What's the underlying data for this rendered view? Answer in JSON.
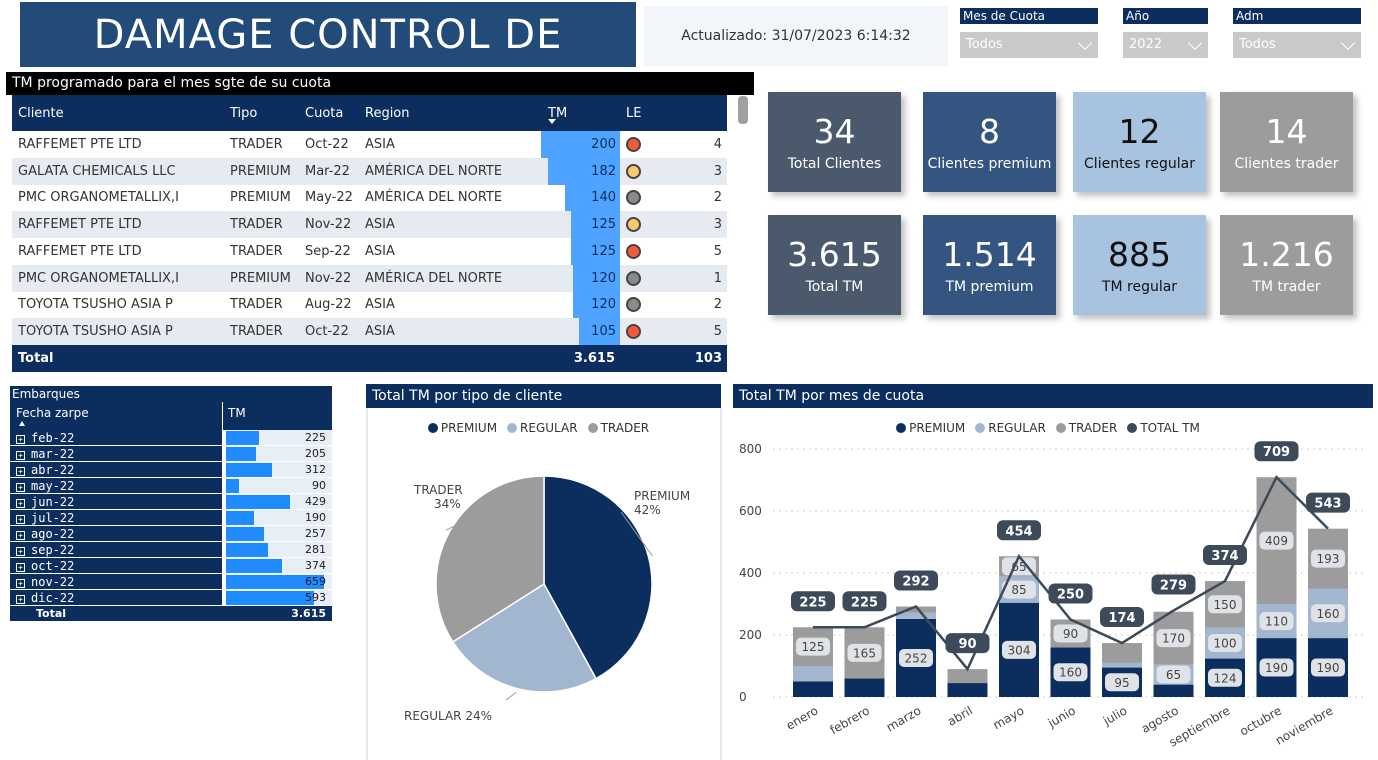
{
  "header": {
    "title": "DAMAGE CONTROL DE",
    "updated": "Actualizado: 31/07/2023 6:14:32"
  },
  "slicers": [
    {
      "label": "Mes de Cuota",
      "value": "Todos"
    },
    {
      "label": "Año",
      "value": "2022"
    },
    {
      "label": "Adm",
      "value": "Todos"
    }
  ],
  "tm_table": {
    "title": "TM programado para el mes sgte de su cuota",
    "columns": {
      "cliente": "Cliente",
      "tipo": "Tipo",
      "cuota": "Cuota",
      "region": "Region",
      "tm": "TM",
      "le": "LE"
    },
    "rows": [
      {
        "cliente": "RAFFEMET PTE LTD",
        "tipo": "TRADER",
        "cuota": "Oct-22",
        "region": "ASIA",
        "tm": "200",
        "le_color": "#f35a3a",
        "le": "4"
      },
      {
        "cliente": "GALATA CHEMICALS LLC",
        "tipo": "PREMIUM",
        "cuota": "Mar-22",
        "region": "AMÉRICA DEL NORTE",
        "tm": "182",
        "le_color": "#f7c96a",
        "le": "3"
      },
      {
        "cliente": "PMC ORGANOMETALLIX,I",
        "tipo": "PREMIUM",
        "cuota": "May-22",
        "region": "AMÉRICA DEL NORTE",
        "tm": "140",
        "le_color": "#8a8a8a",
        "le": "2"
      },
      {
        "cliente": "RAFFEMET PTE LTD",
        "tipo": "TRADER",
        "cuota": "Nov-22",
        "region": "ASIA",
        "tm": "125",
        "le_color": "#f7c96a",
        "le": "3"
      },
      {
        "cliente": "RAFFEMET PTE LTD",
        "tipo": "TRADER",
        "cuota": "Sep-22",
        "region": "ASIA",
        "tm": "125",
        "le_color": "#f35a3a",
        "le": "5"
      },
      {
        "cliente": "PMC ORGANOMETALLIX,I",
        "tipo": "PREMIUM",
        "cuota": "Nov-22",
        "region": "AMÉRICA DEL NORTE",
        "tm": "120",
        "le_color": "#8a8a8a",
        "le": "1"
      },
      {
        "cliente": "TOYOTA TSUSHO ASIA P",
        "tipo": "TRADER",
        "cuota": "Aug-22",
        "region": "ASIA",
        "tm": "120",
        "le_color": "#8a8a8a",
        "le": "2"
      },
      {
        "cliente": "TOYOTA TSUSHO ASIA P",
        "tipo": "TRADER",
        "cuota": "Oct-22",
        "region": "ASIA",
        "tm": "105",
        "le_color": "#f35a3a",
        "le": "5"
      }
    ],
    "total": {
      "label": "Total",
      "tm": "3.615",
      "le": "103"
    }
  },
  "kpis": [
    {
      "value": "34",
      "label": "Total Clientes",
      "cls": "k1"
    },
    {
      "value": "8",
      "label": "Clientes premium",
      "cls": "k2"
    },
    {
      "value": "12",
      "label": "Clientes regular",
      "cls": "k3"
    },
    {
      "value": "14",
      "label": "Clientes trader",
      "cls": "k4"
    },
    {
      "value": "3.615",
      "label": "Total TM",
      "cls": "k1"
    },
    {
      "value": "1.514",
      "label": "TM premium",
      "cls": "k2"
    },
    {
      "value": "885",
      "label": "TM regular",
      "cls": "k3"
    },
    {
      "value": "1.216",
      "label": "TM trader",
      "cls": "k4"
    }
  ],
  "embarques": {
    "title": "Embarques",
    "col_fecha": "Fecha zarpe",
    "col_tm": "TM",
    "rows": [
      {
        "month": "feb-22",
        "tm": 225
      },
      {
        "month": "mar-22",
        "tm": 205
      },
      {
        "month": "abr-22",
        "tm": 312
      },
      {
        "month": "may-22",
        "tm": 90
      },
      {
        "month": "jun-22",
        "tm": 429
      },
      {
        "month": "jul-22",
        "tm": 190
      },
      {
        "month": "ago-22",
        "tm": 257
      },
      {
        "month": "sep-22",
        "tm": 281
      },
      {
        "month": "oct-22",
        "tm": 374
      },
      {
        "month": "nov-22",
        "tm": 659
      },
      {
        "month": "dic-22",
        "tm": 593
      }
    ],
    "total_label": "Total",
    "total": "3.615"
  },
  "chart_data": [
    {
      "type": "pie",
      "title": "Total TM por tipo de cliente",
      "legend": [
        "PREMIUM",
        "REGULAR",
        "TRADER"
      ],
      "slices": [
        {
          "name": "PREMIUM",
          "pct": 42,
          "label": "PREMIUM",
          "pct_label": "42%",
          "color": "#0b2e5e"
        },
        {
          "name": "REGULAR",
          "pct": 24,
          "label": "REGULAR",
          "pct_label": "24%",
          "color": "#a2b7cf"
        },
        {
          "name": "TRADER",
          "pct": 34,
          "label": "TRADER",
          "pct_label": "34%",
          "color": "#9c9c9c"
        }
      ]
    },
    {
      "type": "bar",
      "title": "Total TM por mes de cuota",
      "legend": [
        "PREMIUM",
        "REGULAR",
        "TRADER",
        "TOTAL TM"
      ],
      "colors": {
        "PREMIUM": "#0b2e5e",
        "REGULAR": "#a2b7cf",
        "TRADER": "#9c9c9c",
        "TOTAL TM": "#3d4a5a"
      },
      "categories": [
        "enero",
        "febrero",
        "marzo",
        "abril",
        "mayo",
        "junio",
        "julio",
        "agosto",
        "septiembre",
        "octubre",
        "noviembre"
      ],
      "yticks": [
        0,
        200,
        400,
        600,
        800
      ],
      "ylim": [
        0,
        800
      ],
      "series": [
        {
          "name": "PREMIUM",
          "values": [
            50,
            60,
            252,
            45,
            304,
            160,
            95,
            40,
            124,
            190,
            190
          ]
        },
        {
          "name": "REGULAR",
          "values": [
            50,
            0,
            20,
            0,
            85,
            0,
            15,
            65,
            100,
            110,
            160
          ]
        },
        {
          "name": "TRADER",
          "values": [
            125,
            165,
            20,
            45,
            65,
            90,
            64,
            170,
            150,
            409,
            193
          ]
        }
      ],
      "segment_labels": [
        {
          "PREMIUM": "",
          "REGULAR": "",
          "TRADER": "125"
        },
        {
          "PREMIUM": "",
          "REGULAR": "",
          "TRADER": "165"
        },
        {
          "PREMIUM": "252",
          "REGULAR": "",
          "TRADER": ""
        },
        {
          "PREMIUM": "",
          "REGULAR": "",
          "TRADER": ""
        },
        {
          "PREMIUM": "304",
          "REGULAR": "85",
          "TRADER": "65"
        },
        {
          "PREMIUM": "160",
          "REGULAR": "",
          "TRADER": "90"
        },
        {
          "PREMIUM": "95",
          "REGULAR": "",
          "TRADER": ""
        },
        {
          "PREMIUM": "",
          "REGULAR": "65",
          "TRADER": "170"
        },
        {
          "PREMIUM": "124",
          "REGULAR": "100",
          "TRADER": "150"
        },
        {
          "PREMIUM": "190",
          "REGULAR": "110",
          "TRADER": "409"
        },
        {
          "PREMIUM": "190",
          "REGULAR": "160",
          "TRADER": "193"
        }
      ],
      "totals": [
        225,
        225,
        292,
        90,
        454,
        250,
        174,
        279,
        374,
        709,
        543
      ]
    }
  ]
}
